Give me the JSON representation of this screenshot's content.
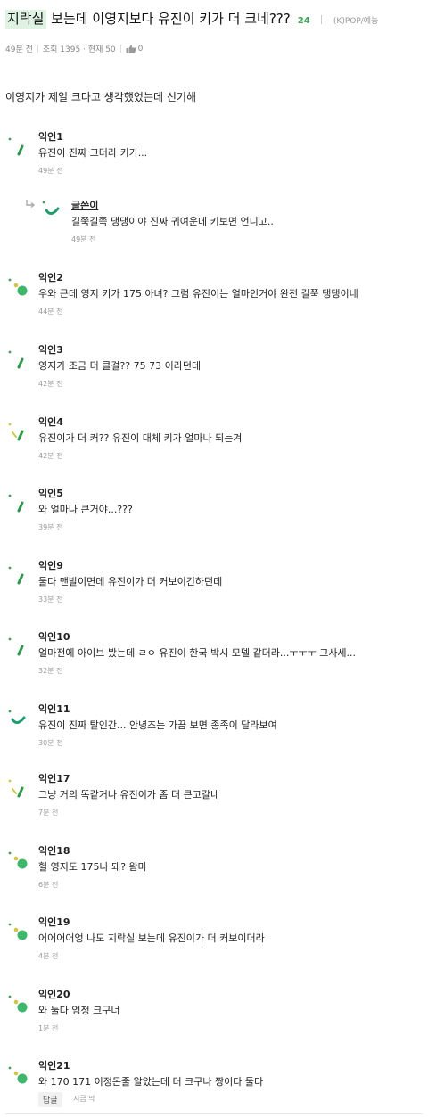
{
  "post": {
    "title_highlight": "지락실",
    "title_rest": " 보는데 이영지보다 유진이 키가 더 크네???",
    "comment_count": "24",
    "category": "(K)POP/예능",
    "time": "49분 전",
    "views": "조회 1395 · 현재 50",
    "likes": "0",
    "body": "이영지가 제일 크다고 생각했었는데 신기해"
  },
  "comments": [
    {
      "name": "익인1",
      "text": "유진이 진짜 크더라 키가...",
      "time": "49분 전",
      "avatar": "green-slash-icon"
    },
    {
      "name": "익인2",
      "text": "우와 근데 영지 키가 175 아녀? 그럼 유진이는 얼마인거야 완전 길쭉 댕댕이네",
      "time": "44분 전",
      "avatar": "green-dots-icon"
    },
    {
      "name": "익인3",
      "text": "영지가 조금 더 클걸?? 75 73 이라던데",
      "time": "42분 전",
      "avatar": "green-slash-icon"
    },
    {
      "name": "익인4",
      "text": "유진이가 더 커?? 유진이 대체 키가 얼마나 되는겨",
      "time": "42분 전",
      "avatar": "yellow-green-slash-icon"
    },
    {
      "name": "익인5",
      "text": "와 얼마나 큰거야...???",
      "time": "39분 전",
      "avatar": "green-slash-icon"
    },
    {
      "name": "익인9",
      "text": "둘다 맨발이면데 유진이가 더 커보이긴하던데",
      "time": "33분 전",
      "avatar": "green-slash-icon"
    },
    {
      "name": "익인10",
      "text": "얼마전에 아이브 봤는데 ㄹㅇ 유진이 한국 박시 모델 같더라...ㅜㅜㅜ 그사세...",
      "time": "32분 전",
      "avatar": "green-slash-icon"
    },
    {
      "name": "익인11",
      "text": "유진이 진짜 탈인간... 안녕즈는 가끔 보면 종족이 달라보여",
      "time": "30분 전",
      "avatar": "teal-curve-icon"
    },
    {
      "name": "익인17",
      "text": "그냥 거의 똑같거나 유진이가 좀 더 큰고갈네",
      "time": "7분 전",
      "avatar": "yellow-green-slash-icon"
    },
    {
      "name": "익인18",
      "text": "헐 영지도 175나 돼? 왐마",
      "time": "6분 전",
      "avatar": "green-dots-icon"
    },
    {
      "name": "익인19",
      "text": "어어어어엉 나도 지락실 보는데 유진이가 더 커보이더라",
      "time": "4분 전",
      "avatar": "green-dots-icon"
    },
    {
      "name": "익인20",
      "text": "와 둘다 엄청 크구너",
      "time": "1분 전",
      "avatar": "green-dots-icon"
    },
    {
      "name": "익인21",
      "text": "와 170 171 이정돈줄 알았는데 더 크구나 짱이다 둘다",
      "time": "지금 막",
      "avatar": "green-dots-icon"
    }
  ],
  "reply": {
    "name": "글쓴이",
    "text": "길쭉길쭉 댕댕이야 진짜 귀여운데 키보면 언니고..",
    "time": "49분 전"
  },
  "reply_button": "답글",
  "colors": {
    "accent": "#3aa655",
    "highlight": "#dff3e3"
  }
}
